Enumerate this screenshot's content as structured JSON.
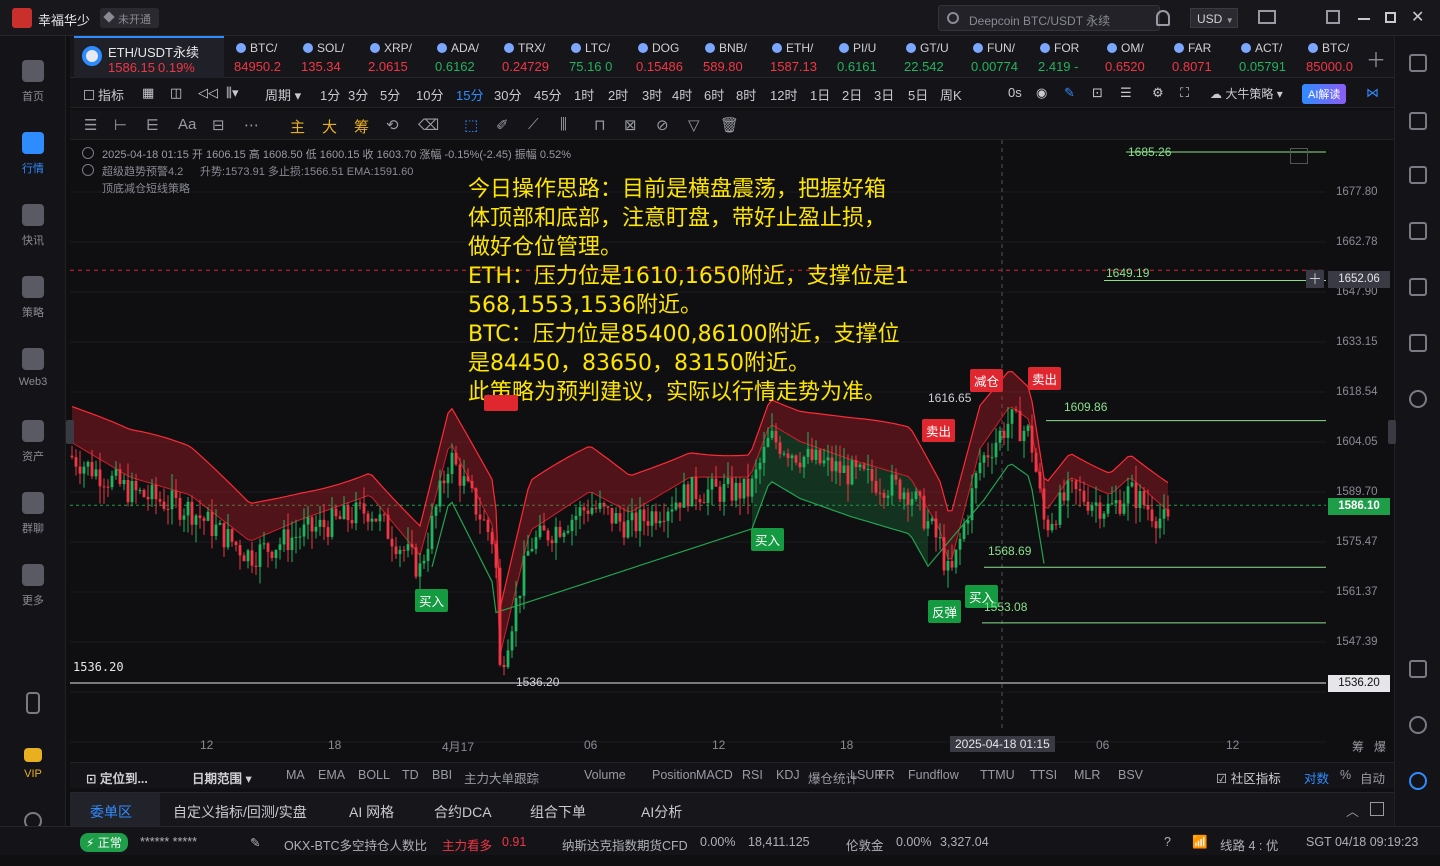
{
  "app": {
    "name": "幸福华少",
    "status": "未开通",
    "search_placeholder": "Deepcoin BTC/USDT 永续",
    "currency": "USD"
  },
  "sidebar": {
    "items": [
      {
        "label": "首页",
        "icon": "home-icon"
      },
      {
        "label": "行情",
        "icon": "chart-icon"
      },
      {
        "label": "快讯",
        "icon": "news-icon"
      },
      {
        "label": "策略",
        "icon": "robot-icon"
      },
      {
        "label": "Web3",
        "icon": "web3-icon"
      },
      {
        "label": "资产",
        "icon": "wallet-icon"
      },
      {
        "label": "群聊",
        "icon": "chat-icon"
      },
      {
        "label": "更多",
        "icon": "grid-icon"
      },
      {
        "label": "",
        "icon": "phone-icon"
      },
      {
        "label": "VIP",
        "icon": "vip-icon"
      },
      {
        "label": "",
        "icon": "settings-icon"
      }
    ]
  },
  "tickers": {
    "main": {
      "name": "ETH/USDT永续",
      "price": "1586.15",
      "change": "0.19%"
    },
    "list": [
      {
        "name": "BTC/",
        "price": "84950.2",
        "dir": "red"
      },
      {
        "name": "SOL/",
        "price": "135.34",
        "dir": "red"
      },
      {
        "name": "XRP/",
        "price": "2.0615",
        "dir": "red"
      },
      {
        "name": "ADA/",
        "price": "0.6162",
        "dir": "green"
      },
      {
        "name": "TRX/",
        "price": "0.24729",
        "dir": "red"
      },
      {
        "name": "LTC/",
        "price": "75.16 0",
        "dir": "green"
      },
      {
        "name": "DOG",
        "price": "0.15486",
        "dir": "red"
      },
      {
        "name": "BNB/",
        "price": "589.80",
        "dir": "red"
      },
      {
        "name": "ETH/",
        "price": "1587.13",
        "dir": "red"
      },
      {
        "name": "PI/U",
        "price": "0.6161",
        "dir": "green"
      },
      {
        "name": "GT/U",
        "price": "22.542",
        "dir": "green"
      },
      {
        "name": "FUN/",
        "price": "0.00774",
        "dir": "green"
      },
      {
        "name": "FOR",
        "price": "2.419 -",
        "dir": "green"
      },
      {
        "name": "OM/",
        "price": "0.6520",
        "dir": "red"
      },
      {
        "name": "FAR",
        "price": "0.8071",
        "dir": "red"
      },
      {
        "name": "ACT/",
        "price": "0.05791",
        "dir": "green"
      },
      {
        "name": "BTC/",
        "price": "85000.0",
        "dir": "red"
      }
    ]
  },
  "toolbar": {
    "indicator_label": "指标",
    "period_label": "周期",
    "timeframes": [
      "1分",
      "3分",
      "5分",
      "10分",
      "15分",
      "30分",
      "45分",
      "1时",
      "2时",
      "3时",
      "4时",
      "6时",
      "8时",
      "12时",
      "1日",
      "2日",
      "3日",
      "5日",
      "周K"
    ],
    "active_timeframe": "15分",
    "right_items": [
      "0s",
      "大牛策略",
      "AI解读"
    ],
    "drawing_tabs": [
      "主",
      "大",
      "筹"
    ]
  },
  "chart_info": {
    "line1": "2025-04-18 01:15  开 1606.15  高 1608.50  低 1600.15  收 1603.70  涨幅 -0.15%(-2.45)  振幅 0.52%",
    "line2_a": "超级趋势预警4.2",
    "line2_b": "升势:1573.91  多止损:1566.51  EMA:1591.60",
    "line3": "顶底减仓短线策略"
  },
  "announcement": {
    "lines": [
      "今日操作思路：目前是横盘震荡，把握好箱",
      "体顶部和底部，注意盯盘，带好止盈止损，",
      "做好仓位管理。",
      "ETH：压力位是1610,1650附近，支撑位是1",
      "568,1553,1536附近。",
      "BTC：压力位是85400,86100附近，支撑位",
      "是84450，83650，83150附近。",
      "此策略为预判建议，实际以行情走势为准。"
    ]
  },
  "price_axis": {
    "ticks": [
      "1677.80",
      "1662.78",
      "1647.90",
      "1633.15",
      "1618.54",
      "1604.05",
      "1589.70",
      "1575.47",
      "1561.37",
      "1547.39",
      "1536.20"
    ],
    "last_price": "1586.10",
    "crosshair_price": "1652.06",
    "low_price": "1536.20"
  },
  "time_axis": {
    "ticks": [
      "12",
      "18",
      "4月17",
      "06",
      "12",
      "18",
      "06",
      "12"
    ],
    "crosshair_time": "2025-04-18 01:15",
    "right_labels": [
      "筹",
      "爆"
    ]
  },
  "chart_labels": {
    "level_1685": "1685.26",
    "level_1649": "1649.19",
    "level_1609": "1609.86",
    "level_1568": "1568.69",
    "level_1553": "1553.08",
    "level_1536": "1536.20",
    "high_1616": "1616.65",
    "left_1536": "1536.20",
    "signals": {
      "reduce": "减仓",
      "sell1": "卖出",
      "sell2": "卖出",
      "buy1": "买入",
      "buy2": "买入",
      "buy3": "买入",
      "rebound": "反弹"
    }
  },
  "chart_data": {
    "type": "candlestick",
    "symbol": "ETH/USDT永续",
    "interval": "15分",
    "ylim": [
      1536.2,
      1685.26
    ],
    "last": 1586.1,
    "high_marker": 1616.65,
    "low_marker": 1536.2,
    "resistance": [
      1685.26,
      1649.19,
      1609.86
    ],
    "support": [
      1568.69,
      1553.08,
      1536.2
    ],
    "indicators": {
      "ema": 1591.6,
      "trend_up": 1573.91,
      "long_stop": 1566.51
    }
  },
  "indicator_bar": {
    "left": [
      "定位到...",
      "日期范围"
    ],
    "items": [
      "MA",
      "EMA",
      "BOLL",
      "TD",
      "BBI",
      "主力大单跟踪",
      "Volume",
      "Position",
      "MACD",
      "RSI",
      "KDJ",
      "爆仓统计",
      "LSUR",
      "FR",
      "Fundflow",
      "TTMU",
      "TTSI",
      "MLR",
      "BSV"
    ],
    "right": [
      "社区指标",
      "对数",
      "%",
      "自动"
    ]
  },
  "bottom_tabs": [
    "委单区",
    "自定义指标/回测/实盘",
    "AI 网格",
    "合约DCA",
    "组合下单",
    "AI分析"
  ],
  "statusbar": {
    "status": "正常",
    "account": "******  *****",
    "items": [
      {
        "label": "OKX-BTC多空持仓人数比",
        "sub": "主力看多",
        "value": "0.91"
      },
      {
        "label": "纳斯达克指数期货CFD",
        "sub": "0.00%",
        "value": "18,411.125"
      },
      {
        "label": "伦敦金",
        "sub": "0.00%",
        "value": "3,327.04"
      }
    ],
    "line": "线路 4 : 优",
    "time": "SGT 04/18 09:19:23"
  },
  "colors": {
    "up": "#22b35e",
    "down": "#f23645",
    "accent": "#2f8cff",
    "announce": "#ffe600"
  }
}
